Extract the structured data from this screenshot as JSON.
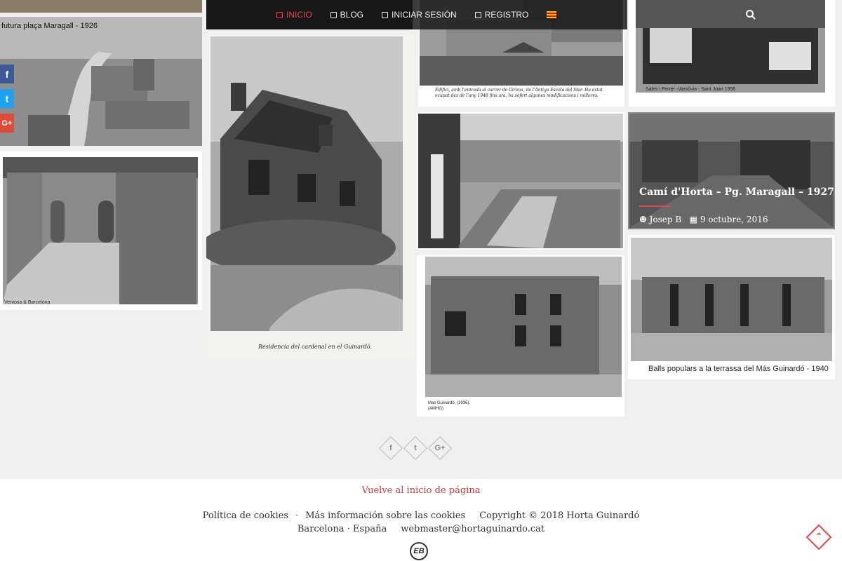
{
  "nav": {
    "items": [
      {
        "label": "INICIO",
        "icon": "home-icon",
        "active": true
      },
      {
        "label": "BLOG",
        "icon": "blog-icon",
        "active": false
      },
      {
        "label": "INICIAR SESIÓN",
        "icon": "edit-icon",
        "active": false
      },
      {
        "label": "REGISTRO",
        "icon": "edit-icon",
        "active": false
      }
    ],
    "language_icon": "catalan-flag-icon",
    "search_icon": "search-icon"
  },
  "social": {
    "facebook": "f",
    "twitter": "t",
    "googleplus": "G+"
  },
  "photos": {
    "maragall_caption": "futura plaça Maragall - 1926",
    "cardenal_caption": "Residencia del cardenal en el Guinardó.",
    "escola_caption": "Edifici, amb l'entrada al carrer de Girona, de l'Antiga Escola del Mar. Ha estat ocupat des de l'any 1948 fins ara, ha sofert algunes modificacions i millores.",
    "sales_caption": "Sales i Ferrer -Varsòvia - Sant Joan 1956",
    "mas_caption_1": "Mas Guinardó, (1936).",
    "mas_caption_2": "(AMHG)",
    "balls_caption": "Balls populars a la terrassa del Más Guinardó - 1940",
    "wall_stamp": "Ventosa & Barcelona"
  },
  "featured": {
    "title": "Camí d'Horta – Pg. Maragall – 1927",
    "author": "Josep B",
    "date": "9 octubre, 2016"
  },
  "share": [
    "f",
    "t",
    "G+"
  ],
  "footer": {
    "back_to_top": "Vuelve al inicio de página",
    "cookies_policy": "Política de cookies",
    "separator": "·",
    "more_cookies": "Más información sobre las cookies",
    "copyright": "Copyright © 2018 Horta Guinardó",
    "location": "Barcelona · España",
    "email": "webmaster@hortaguinardo.cat",
    "logo_text": "EB"
  },
  "colors": {
    "accent": "#e84545",
    "nav_bg": "#141414",
    "page_bg": "#f0f0f0",
    "facebook": "#3b5998",
    "twitter": "#1da1f2",
    "googleplus": "#dd4b39"
  }
}
